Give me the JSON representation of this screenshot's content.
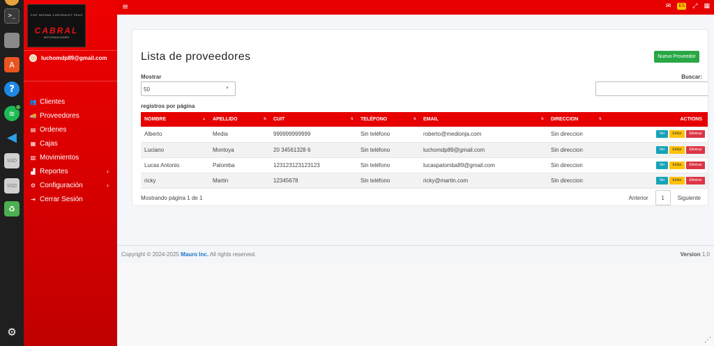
{
  "dock": {
    "terminal_glyph": ">_",
    "help_glyph": "?",
    "ssd1": "SSD",
    "ssd2": "SSD",
    "trash_glyph": "♻"
  },
  "sidebar": {
    "logo": {
      "brands": "FIAT NISSAN CHEVROLET PEUGEOT MERCEDES",
      "name": "CABRAL",
      "sub": "MOTORIZACIONES"
    },
    "user_email": "luchomdp89@gmail.com",
    "items": [
      {
        "label": "Clientes",
        "icon": "users-icon",
        "glyph": "👥",
        "caret": ""
      },
      {
        "label": "Proveedores",
        "icon": "truck-icon",
        "glyph": "🚚",
        "caret": ""
      },
      {
        "label": "Ordenes",
        "icon": "document-icon",
        "glyph": "▤",
        "caret": ""
      },
      {
        "label": "Cajas",
        "icon": "cash-icon",
        "glyph": "▦",
        "caret": ""
      },
      {
        "label": "Movimientos",
        "icon": "ledger-icon",
        "glyph": "▥",
        "caret": ""
      },
      {
        "label": "Reportes",
        "icon": "chart-icon",
        "glyph": "▟",
        "caret": "‹"
      },
      {
        "label": "Configuración",
        "icon": "gear-icon",
        "glyph": "⚙",
        "caret": "‹"
      },
      {
        "label": "Cerrar Sesión",
        "icon": "logout-icon",
        "glyph": "⇥",
        "caret": ""
      }
    ]
  },
  "topbar": {
    "menu_glyph": "≡",
    "right_icons": [
      "comments-icon",
      "language-flag-icon",
      "fullscreen-icon",
      "grid-icon"
    ]
  },
  "page": {
    "title": "Lista de proveedores",
    "new_button": "Nuevo Proveedor",
    "show_label": "Mostrar",
    "show_value": "50",
    "search_label": "Buscar:",
    "per_page_label": "registros por página"
  },
  "table": {
    "headers": [
      "NOMBRE",
      "APELLIDO",
      "CUIT",
      "TELÉFONO",
      "EMAIL",
      "DIRECCION",
      "ACTIONS"
    ],
    "rows": [
      [
        "Alberto",
        "Media",
        "999999999999",
        "Sin teléfono",
        "roberto@medionja.com",
        "Sin direccion"
      ],
      [
        "Luciano",
        "Montoya",
        "20 34561328 6",
        "Sin teléfono",
        "luchomdp89@gmail.com",
        "Sin direccion"
      ],
      [
        "Lucas Antonio",
        "Palomba",
        "123123123123123",
        "Sin teléfono",
        "lucaspalomba89@gmail.com",
        "Sin direccion"
      ],
      [
        "ricky",
        "Martin",
        "12345678",
        "Sin teléfono",
        "ricky@martin.com",
        "Sin direccion"
      ]
    ],
    "actions": {
      "view": "Ver",
      "edit": "Editar",
      "delete": "Eliminar"
    }
  },
  "pagination": {
    "info": "Mostrando página 1 de 1",
    "prev": "Anterior",
    "current": "1",
    "next": "Siguiente"
  },
  "footer": {
    "copyright": "Copyright © 2024-2025",
    "company": "Mauro Inc.",
    "rights": "All rights reserved.",
    "version_label": "Version",
    "version": "1.0"
  },
  "colors": {
    "primary_red": "#e60000",
    "success": "#28a745",
    "info": "#17a2b8",
    "warning": "#ffc107",
    "danger": "#dc3545"
  }
}
